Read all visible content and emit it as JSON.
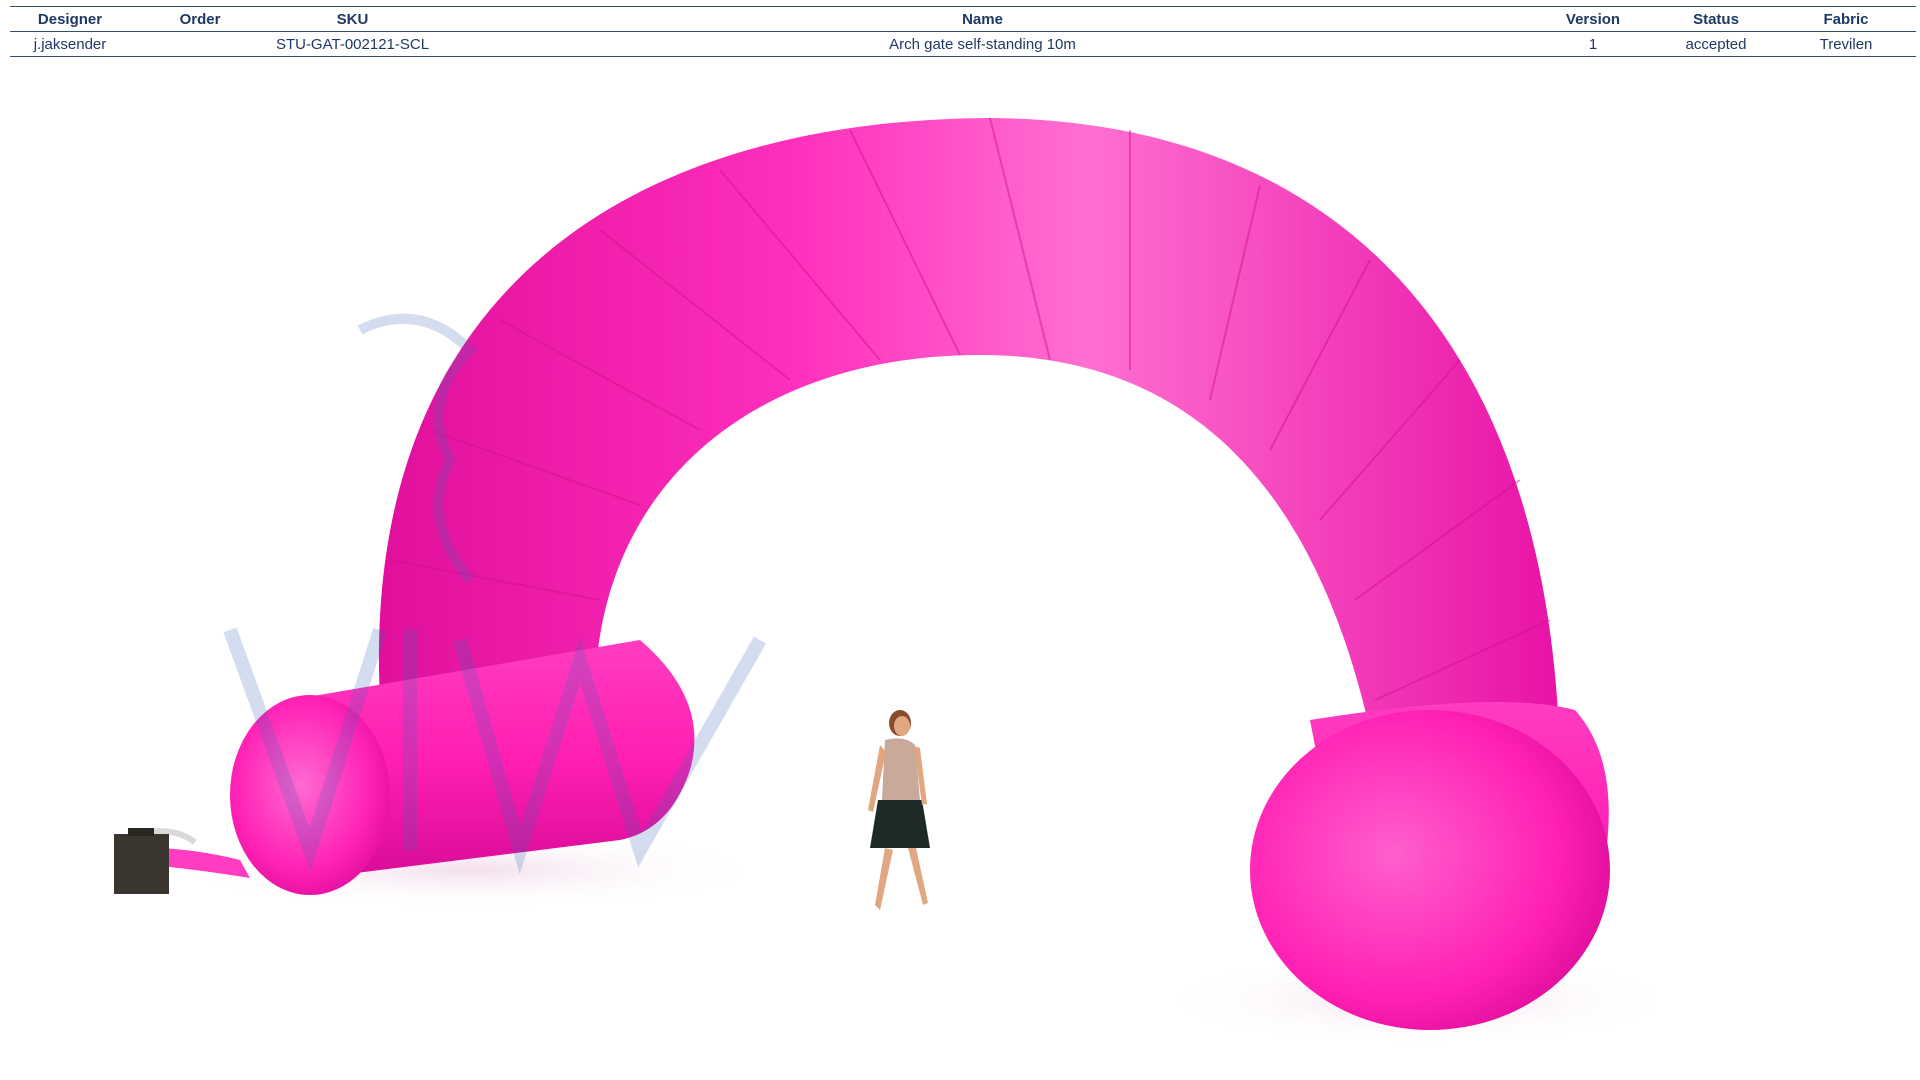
{
  "spec_table": {
    "headers": {
      "designer": "Designer",
      "order": "Order",
      "sku": "SKU",
      "name": "Name",
      "version": "Version",
      "status": "Status",
      "fabric": "Fabric"
    },
    "row": {
      "designer": "j.jaksender",
      "order": "",
      "sku": "STU-GAT-002121-SCL",
      "name": "Arch gate self-standing 10m",
      "version": "1",
      "status": "accepted",
      "fabric": "Trevilen"
    }
  },
  "render": {
    "arch_color": "#ff1fb4",
    "arch_highlight": "#ff8fdc",
    "arch_shadow": "#d10d8e",
    "watermark_color": "#3a63b8",
    "blower_color": "#3b3530",
    "text_color": "#1f3864"
  }
}
